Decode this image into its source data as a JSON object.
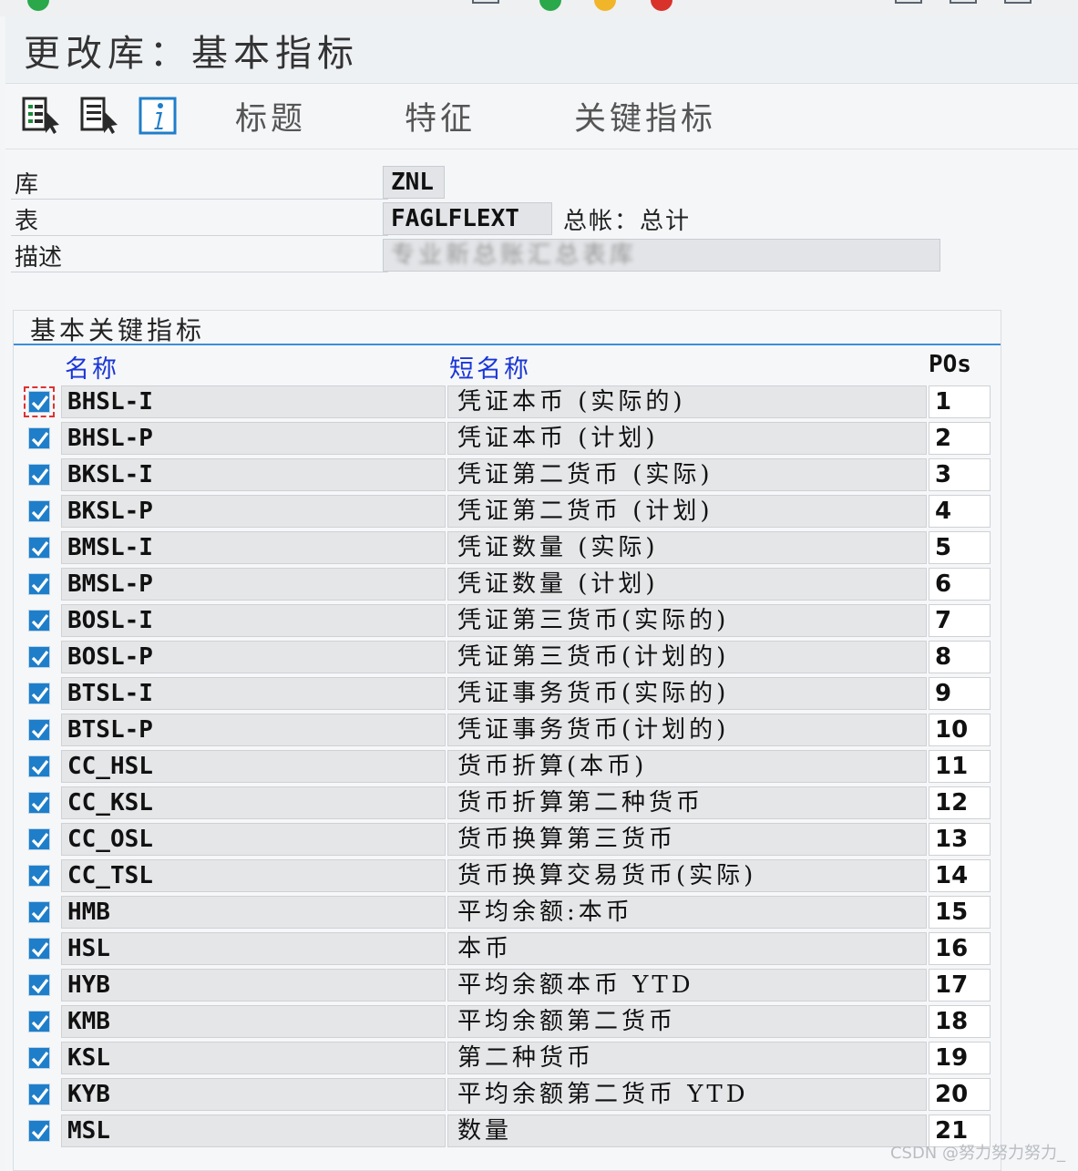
{
  "window": {
    "title": "更改库：基本指标"
  },
  "toolbar": {
    "icons": [
      "select-all-icon",
      "deselect-all-icon",
      "info-icon"
    ],
    "tabs": [
      "标题",
      "特征",
      "关键指标"
    ]
  },
  "header": {
    "library_label": "库",
    "library_value": "ZNL",
    "table_label": "表",
    "table_value": "FAGLFLEXT",
    "table_note": "总帐：总计",
    "desc_label": "描述",
    "desc_value": "专业新总账汇总表库"
  },
  "group": {
    "title": "基本关键指标",
    "col_name": "名称",
    "col_short": "短名称",
    "col_pos": "POs"
  },
  "rows": [
    {
      "name": "BHSL-I",
      "short": "凭证本币 (实际的)",
      "pos": "1"
    },
    {
      "name": "BHSL-P",
      "short": "凭证本币 (计划)",
      "pos": "2"
    },
    {
      "name": "BKSL-I",
      "short": "凭证第二货币 (实际)",
      "pos": "3"
    },
    {
      "name": "BKSL-P",
      "short": "凭证第二货币 (计划)",
      "pos": "4"
    },
    {
      "name": "BMSL-I",
      "short": "凭证数量 (实际)",
      "pos": "5"
    },
    {
      "name": "BMSL-P",
      "short": "凭证数量 (计划)",
      "pos": "6"
    },
    {
      "name": "BOSL-I",
      "short": "凭证第三货币(实际的)",
      "pos": "7"
    },
    {
      "name": "BOSL-P",
      "short": "凭证第三货币(计划的)",
      "pos": "8"
    },
    {
      "name": "BTSL-I",
      "short": "凭证事务货币(实际的)",
      "pos": "9"
    },
    {
      "name": "BTSL-P",
      "short": "凭证事务货币(计划的)",
      "pos": "10"
    },
    {
      "name": "CC_HSL",
      "short": "货币折算(本币)",
      "pos": "11"
    },
    {
      "name": "CC_KSL",
      "short": "货币折算第二种货币",
      "pos": "12"
    },
    {
      "name": "CC_OSL",
      "short": "货币换算第三货币",
      "pos": "13"
    },
    {
      "name": "CC_TSL",
      "short": "货币换算交易货币(实际)",
      "pos": "14"
    },
    {
      "name": "HMB",
      "short": "平均余额:本币",
      "pos": "15"
    },
    {
      "name": "HSL",
      "short": "本币",
      "pos": "16"
    },
    {
      "name": "HYB",
      "short": "平均余额本币 YTD",
      "pos": "17"
    },
    {
      "name": "KMB",
      "short": "平均余额第二货币",
      "pos": "18"
    },
    {
      "name": "KSL",
      "short": "第二种货币",
      "pos": "19"
    },
    {
      "name": "KYB",
      "short": "平均余额第二货币 YTD",
      "pos": "20"
    },
    {
      "name": "MSL",
      "short": "数量",
      "pos": "21"
    }
  ],
  "watermark": "CSDN @努力努力努力_",
  "colors": {
    "accent_rule": "#3b8fd6",
    "column_header": "#1a36d6",
    "checkbox": "#1f7ec9"
  }
}
